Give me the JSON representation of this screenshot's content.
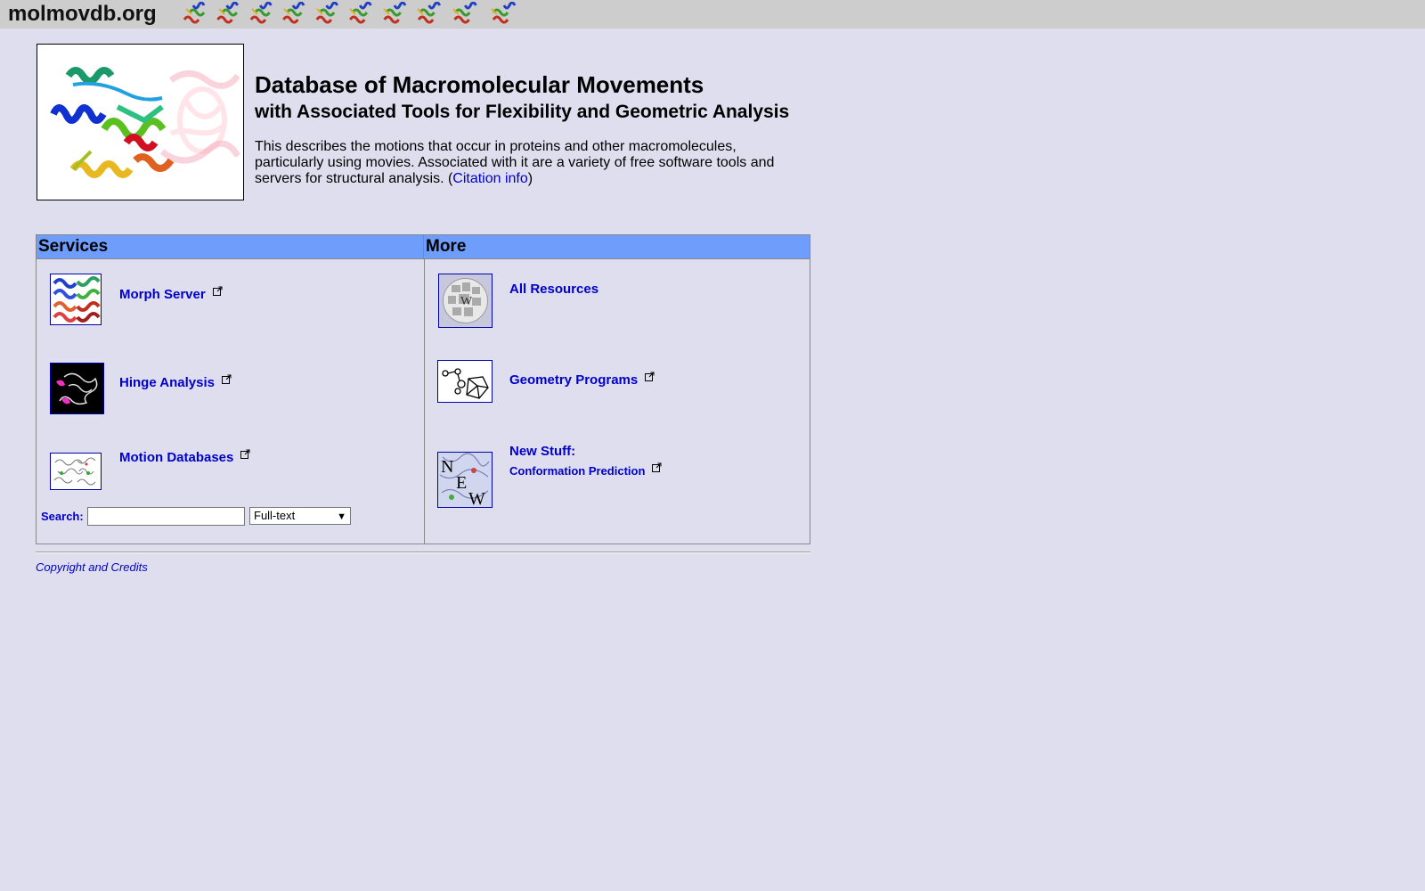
{
  "topbar": {
    "logo": "molmovdb.org",
    "molecule_icon_count": 10
  },
  "header": {
    "title": "Database of Macromolecular Movements",
    "subtitle": "with Associated Tools for Flexibility and Geometric Analysis",
    "description_text": "This describes the motions that occur in proteins and other macromolecules, particularly using movies. Associated with it are a variety of free software tools and servers for structural analysis. (",
    "citation_link": "Citation info",
    "description_close": ")"
  },
  "services": {
    "heading": "Services",
    "items": [
      {
        "label": "Morph Server",
        "icon": "morph-thumbnail"
      },
      {
        "label": "Hinge Analysis",
        "icon": "hinge-thumbnail"
      },
      {
        "label": "Motion Databases",
        "icon": "motion-db-thumbnail"
      }
    ],
    "search": {
      "label": "Search:",
      "value": "",
      "placeholder": "",
      "mode_selected": "Full-text"
    }
  },
  "more": {
    "heading": "More",
    "items": [
      {
        "label": "All Resources",
        "icon": "wikipedia-globe-thumbnail"
      },
      {
        "label": "Geometry Programs",
        "icon": "geometry-thumbnail"
      },
      {
        "label": "New Stuff:",
        "sublabel": "Conformation Prediction",
        "icon": "new-thumbnail"
      }
    ]
  },
  "footer": {
    "copyright": "Copyright and Credits"
  },
  "colors": {
    "page_bg": "#dedeee",
    "topbar_bg": "#cdcdcd",
    "table_header_bg": "#6e9dfb",
    "link": "#0000cc"
  }
}
